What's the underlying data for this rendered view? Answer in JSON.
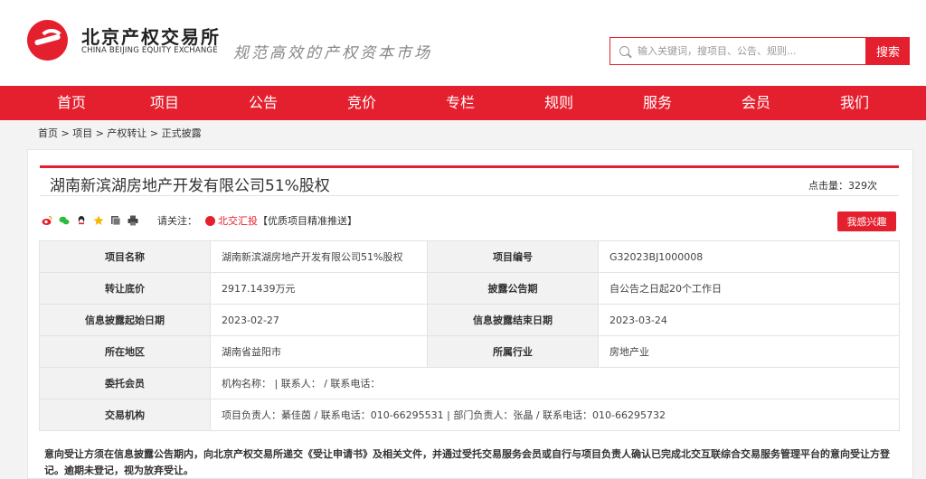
{
  "header": {
    "brand_cn": "北京产权交易所",
    "brand_en": "CHINA BEIJING EQUITY EXCHANGE",
    "slogan": "规范高效的产权资本市场",
    "search_placeholder": "输入关键词，搜项目、公告、规则...",
    "search_button": "搜索",
    "accent_color": "#e5202e"
  },
  "nav": [
    "首页",
    "项目",
    "公告",
    "竞价",
    "专栏",
    "规则",
    "服务",
    "会员",
    "我们"
  ],
  "breadcrumb": "首页 > 项目 > 产权转让 > 正式披露",
  "project": {
    "title": "湖南新滨湖房地产开发有限公司51%股权",
    "views_label": "点击量：",
    "views_value": "329次",
    "follow_label": "请关注：",
    "follow_account": "北交汇投",
    "follow_tag": "【优质项目精准推送】",
    "interest_button": "我感兴趣"
  },
  "share_icons": [
    "weibo-icon",
    "wechat-icon",
    "qq-icon",
    "favorite-star-icon",
    "copy-icon",
    "print-icon"
  ],
  "table": {
    "r1": {
      "k1": "项目名称",
      "v1": "湖南新滨湖房地产开发有限公司51%股权",
      "k2": "项目编号",
      "v2": "G32023BJ1000008"
    },
    "r2": {
      "k1": "转让底价",
      "v1": "2917.1439万元",
      "k2": "披露公告期",
      "v2": "自公告之日起20个工作日"
    },
    "r3": {
      "k1": "信息披露起始日期",
      "v1": "2023-02-27",
      "k2": "信息披露结束日期",
      "v2": "2023-03-24"
    },
    "r4": {
      "k1": "所在地区",
      "v1": "湖南省益阳市",
      "k2": "所属行业",
      "v2": "房地产业"
    },
    "r5": {
      "k1": "委托会员",
      "v1": "机构名称： | 联系人： / 联系电话："
    },
    "r6": {
      "k1": "交易机构",
      "v1": "项目负责人：綦佳茵 / 联系电话：010-66295531 | 部门负责人：张晶 / 联系电话：010-66295732"
    }
  },
  "notice": "意向受让方须在信息披露公告期内，向北京产权交易所递交《受让申请书》及相关文件，并通过受托交易服务会员或自行与项目负责人确认已完成北交互联综合交易服务管理平台的意向受让方登记。逾期未登记，视为放弃受让。"
}
